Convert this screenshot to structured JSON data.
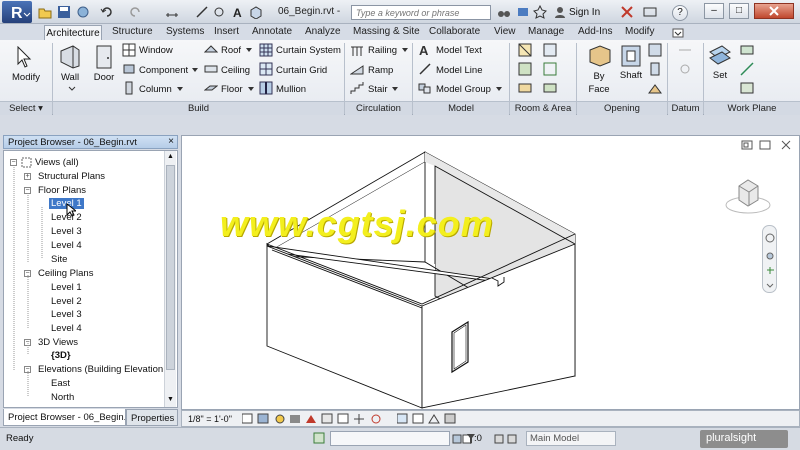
{
  "titlebar": {
    "doc_title": "06_Begin.rvt -",
    "search_placeholder": "Type a keyword or phrase",
    "sign_in": "Sign In",
    "help": "?",
    "minimize": "–",
    "restore": "□"
  },
  "tabs": [
    "Architecture",
    "Structure",
    "Systems",
    "Insert",
    "Annotate",
    "Analyze",
    "Massing & Site",
    "Collaborate",
    "View",
    "Manage",
    "Add-Ins",
    "Modify"
  ],
  "ribbon": {
    "modify": "Modify",
    "wall": "Wall",
    "door": "Door",
    "window": "Window",
    "component": "Component",
    "column": "Column",
    "roof": "Roof",
    "ceiling": "Ceiling",
    "floor": "Floor",
    "curtain_system": "Curtain System",
    "curtain_grid": "Curtain Grid",
    "mullion": "Mullion",
    "railing": "Railing",
    "ramp": "Ramp",
    "stair": "Stair",
    "model_text": "Model Text",
    "model_line": "Model Line",
    "model_group": "Model Group",
    "by_face": "By Face",
    "shaft": "Shaft",
    "set": "Set",
    "panels": {
      "select": "Select",
      "build": "Build",
      "circulation": "Circulation",
      "model": "Model",
      "room_area": "Room & Area",
      "opening": "Opening",
      "datum": "Datum",
      "work_plane": "Work Plane"
    }
  },
  "browser": {
    "title": "Project Browser - 06_Begin.rvt",
    "close": "×",
    "tree": {
      "views": "Views (all)",
      "structural_plans": "Structural Plans",
      "floor_plans": "Floor Plans",
      "fp_level1": "Level 1",
      "fp_level2": "Level 2",
      "fp_level3": "Level 3",
      "fp_level4": "Level 4",
      "fp_site": "Site",
      "ceiling_plans": "Ceiling Plans",
      "cp_level1": "Level 1",
      "cp_level2": "Level 2",
      "cp_level3": "Level 3",
      "cp_level4": "Level 4",
      "views_3d": "3D Views",
      "view_3d": "{3D}",
      "elevations": "Elevations (Building Elevation",
      "east": "East",
      "north": "North"
    },
    "tabs": {
      "browser_tab": "Project Browser - 06_Begin.r...",
      "properties_tab": "Properties"
    }
  },
  "viewbar": {
    "scale": "1/8\" = 1'-0\""
  },
  "status": {
    "ready": "Ready",
    "count": ":0",
    "model": "Main Model",
    "brand": "pluralsight"
  },
  "watermark": "www.cgtsj.com",
  "colors": {
    "selection": "#3f78c8",
    "watermark": "#f3ef1e",
    "wall_shade": "#e4e4e4"
  }
}
